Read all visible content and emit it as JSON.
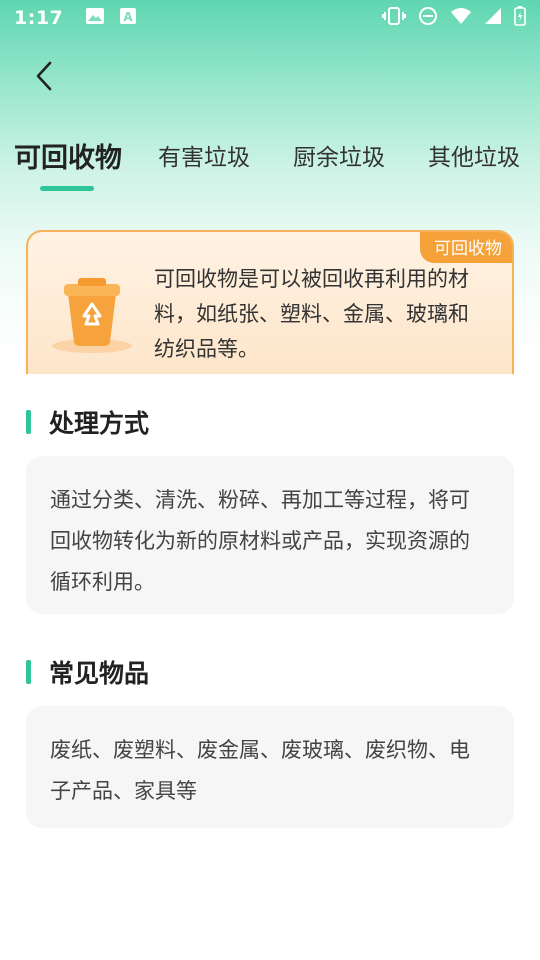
{
  "status_bar": {
    "time": "1:17"
  },
  "tabs": [
    {
      "label": "可回收物",
      "active": true
    },
    {
      "label": "有害垃圾",
      "active": false
    },
    {
      "label": "厨余垃圾",
      "active": false
    },
    {
      "label": "其他垃圾",
      "active": false
    }
  ],
  "info_card": {
    "badge": "可回收物",
    "description": "可回收物是可以被回收再利用的材料，如纸张、塑料、金属、玻璃和纺织品等。",
    "icon": "recycle-bin-icon",
    "accent_color": "#f6a23a"
  },
  "sections": {
    "processing": {
      "title": "处理方式",
      "content": "通过分类、清洗、粉碎、再加工等过程，将可回收物转化为新的原材料或产品，实现资源的循环利用。"
    },
    "common_items": {
      "title": "常见物品",
      "content": "废纸、废塑料、废金属、废玻璃、废织物、电子产品、家具等"
    }
  },
  "theme": {
    "primary": "#2fc49a",
    "card_bg": "#f6f6f6"
  }
}
